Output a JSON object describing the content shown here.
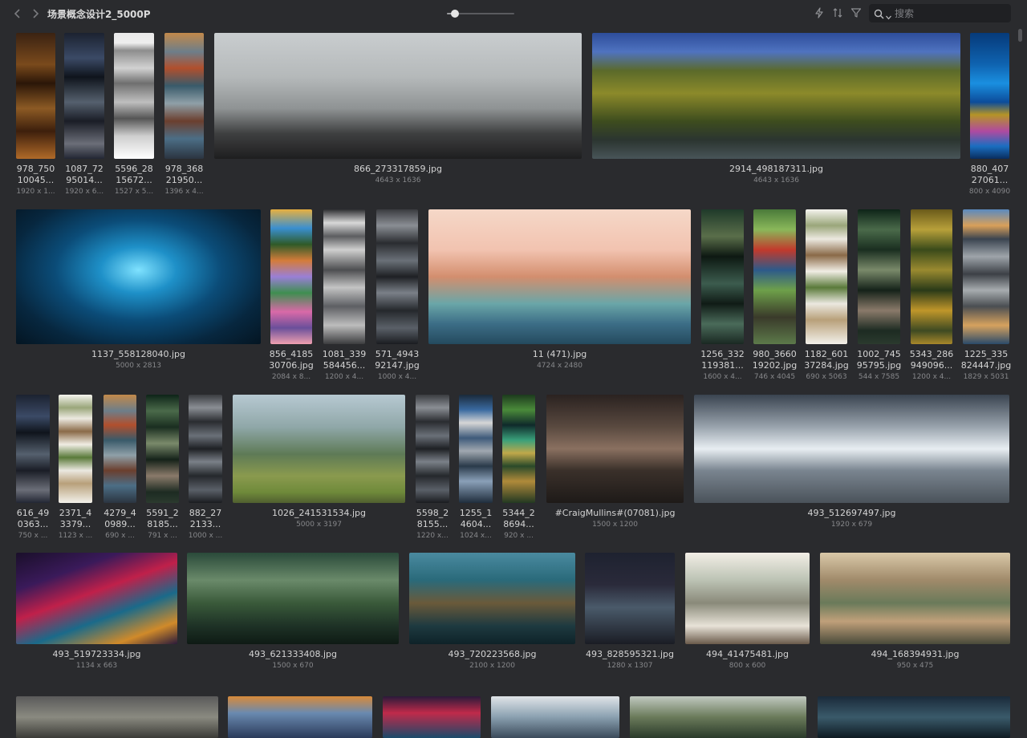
{
  "toolbar": {
    "title": "场景概念设计2_5000P",
    "zoom_slider": {
      "value": 0.12
    },
    "search": {
      "value": "",
      "placeholder": "搜索"
    }
  },
  "gallery": [
    {
      "name": "978_750\n10045...",
      "dims": "1920 x 1...",
      "style": "bg-dark-gold"
    },
    {
      "name": "1087_72\n95014...",
      "dims": "1920 x 6...",
      "style": "bg-night"
    },
    {
      "name": "5596_28\n15672...",
      "dims": "1527 x 5...",
      "style": "bg-sketch"
    },
    {
      "name": "978_368\n21950...",
      "dims": "1396 x 4...",
      "style": "bg-color-strip"
    },
    {
      "name": "866_273317859.jpg",
      "dims": "4643 x 1636",
      "style": "bg-grey-china"
    },
    {
      "name": "2914_498187311.jpg",
      "dims": "4643 x 1636",
      "style": "bg-green-hills"
    },
    {
      "name": "880_407\n27061...",
      "dims": "800 x 4090",
      "style": "bg-blue-ice"
    },
    {
      "name": "1137_558128040.jpg",
      "dims": "5000 x 2813",
      "style": "bg-cave"
    },
    {
      "name": "856_4185\n30706.jpg",
      "dims": "2084 x 8...",
      "style": "bg-colorful-strip"
    },
    {
      "name": "1081_339\n584456...",
      "dims": "1200 x 4...",
      "style": "bg-grey-dragon"
    },
    {
      "name": "571_4943\n92147.jpg",
      "dims": "1000 x 4...",
      "style": "bg-greys2"
    },
    {
      "name": "11 (471).jpg",
      "dims": "4724 x 2480",
      "style": "bg-pastel"
    },
    {
      "name": "1256_332\n119381...",
      "dims": "1600 x 4...",
      "style": "bg-dark-green"
    },
    {
      "name": "980_3660\n19202.jpg",
      "dims": "746 x 4045",
      "style": "bg-green-red"
    },
    {
      "name": "1182_601\n37284.jpg",
      "dims": "690 x 5063",
      "style": "bg-white-sketch"
    },
    {
      "name": "1002_745\n95795.jpg",
      "dims": "544 x 7585",
      "style": "bg-jungle"
    },
    {
      "name": "5343_286\n949096...",
      "dims": "1200 x 4...",
      "style": "bg-yellow-green"
    },
    {
      "name": "1225_335\n824447.jpg",
      "dims": "1829 x 5031",
      "style": "bg-mountains"
    },
    {
      "name": "616_49\n0363...",
      "dims": "750 x ...",
      "style": "bg-night"
    },
    {
      "name": "2371_4\n3379...",
      "dims": "1123 x ...",
      "style": "bg-white-sketch"
    },
    {
      "name": "4279_4\n0989...",
      "dims": "690 x ...",
      "style": "bg-color-strip"
    },
    {
      "name": "5591_2\n8185...",
      "dims": "791 x ...",
      "style": "bg-jungle"
    },
    {
      "name": "882_27\n2133...",
      "dims": "1000 x ...",
      "style": "bg-greys2"
    },
    {
      "name": "1026_241531534.jpg",
      "dims": "5000 x 3197",
      "style": "bg-valley"
    },
    {
      "name": "5598_2\n8155...",
      "dims": "1220 x...",
      "style": "bg-greys2"
    },
    {
      "name": "1255_1\n4604...",
      "dims": "1024 x...",
      "style": "bg-blues2"
    },
    {
      "name": "5344_2\n8694...",
      "dims": "920 x ...",
      "style": "bg-greens2"
    },
    {
      "name": "#CraigMullins#(07081).jpg",
      "dims": "1500 x 1200",
      "style": "bg-industrial"
    },
    {
      "name": "493_512697497.jpg",
      "dims": "1920 x 679",
      "style": "bg-scifi"
    },
    {
      "name": "493_519723334.jpg",
      "dims": "1134 x 663",
      "style": "bg-neon"
    },
    {
      "name": "493_621333408.jpg",
      "dims": "1500 x 670",
      "style": "bg-jungle2"
    },
    {
      "name": "493_720223568.jpg",
      "dims": "2100 x 1200",
      "style": "bg-teal-temple"
    },
    {
      "name": "493_828595321.jpg",
      "dims": "1280 x 1307",
      "style": "bg-dark-falls"
    },
    {
      "name": "494_41475481.jpg",
      "dims": "800 x 600",
      "style": "bg-book"
    },
    {
      "name": "494_168394931.jpg",
      "dims": "950 x 475",
      "style": "bg-warm-city"
    },
    {
      "name": "",
      "dims": "",
      "style": "bg-row5a"
    },
    {
      "name": "",
      "dims": "",
      "style": "bg-row5b"
    },
    {
      "name": "",
      "dims": "",
      "style": "bg-row5c"
    },
    {
      "name": "",
      "dims": "",
      "style": "bg-row5d"
    },
    {
      "name": "",
      "dims": "",
      "style": "bg-row5e"
    },
    {
      "name": "",
      "dims": "",
      "style": "bg-row5f"
    }
  ]
}
